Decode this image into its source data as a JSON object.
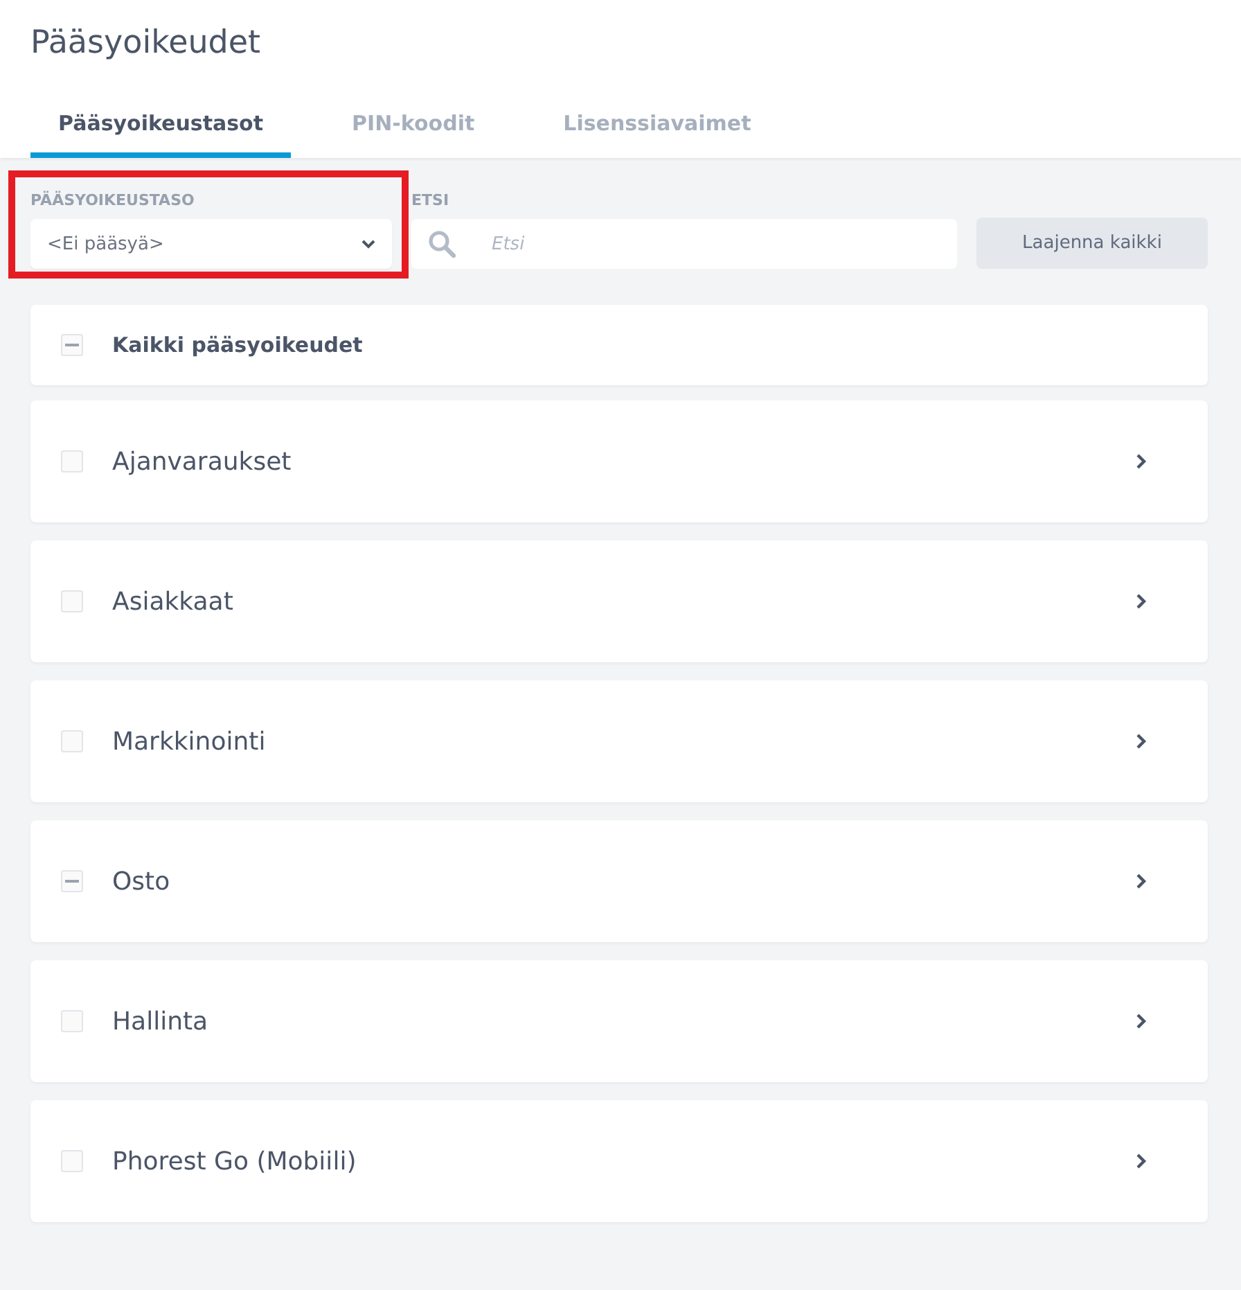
{
  "page_title": "Pääsyoikeudet",
  "tabs": [
    {
      "label": "Pääsyoikeustasot",
      "selected": true
    },
    {
      "label": "PIN-koodit",
      "selected": false
    },
    {
      "label": "Lisenssiavaimet",
      "selected": false
    }
  ],
  "level_filter": {
    "label": "PÄÄSYOIKEUSTASO",
    "value": "<Ei pääsyä>",
    "highlighted": true
  },
  "search": {
    "label": "ETSI",
    "placeholder": "Etsi"
  },
  "expand_button": "Laajenna kaikki",
  "all_row": {
    "label": "Kaikki pääsyoikeudet",
    "partial": true
  },
  "groups": [
    {
      "label": "Ajanvaraukset",
      "partial": false
    },
    {
      "label": "Asiakkaat",
      "partial": false
    },
    {
      "label": "Markkinointi",
      "partial": false
    },
    {
      "label": "Osto",
      "partial": true
    },
    {
      "label": "Hallinta",
      "partial": false
    },
    {
      "label": "Phorest Go (Mobiili)",
      "partial": false
    }
  ]
}
